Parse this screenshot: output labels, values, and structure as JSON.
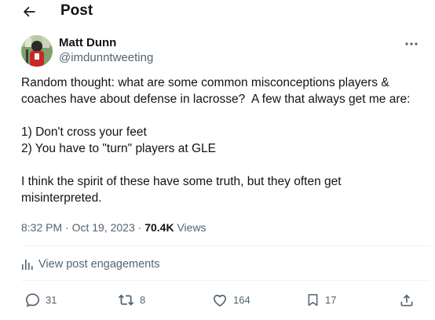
{
  "header": {
    "title": "Post"
  },
  "author": {
    "name": "Matt Dunn",
    "handle": "@imdunntweeting"
  },
  "post": {
    "lines": [
      "Random thought: what are some common misconceptions players &",
      "coaches have about defense in lacrosse?  A few that always get me are:",
      "",
      "1) Don't cross your feet",
      "2) You have to \"turn\" players at GLE",
      "",
      "I think the spirit of these have some truth, but they often get",
      "misinterpreted."
    ]
  },
  "meta": {
    "time": "8:32 PM",
    "date": "Oct 19, 2023",
    "separator": "·",
    "views_count": "70.4K",
    "views_label": "Views"
  },
  "engagements": {
    "label": "View post engagements"
  },
  "actions": {
    "replies": "31",
    "reposts": "8",
    "likes": "164",
    "bookmarks": "17"
  },
  "icons": {
    "back": "arrow-left-icon",
    "more": "more-horizontal-icon",
    "engagements": "analytics-icon",
    "reply": "reply-icon",
    "repost": "repost-icon",
    "like": "heart-icon",
    "bookmark": "bookmark-icon",
    "share": "share-icon"
  },
  "colors": {
    "text": "#0f1419",
    "secondary": "#536471",
    "divider": "#eff3f4"
  }
}
